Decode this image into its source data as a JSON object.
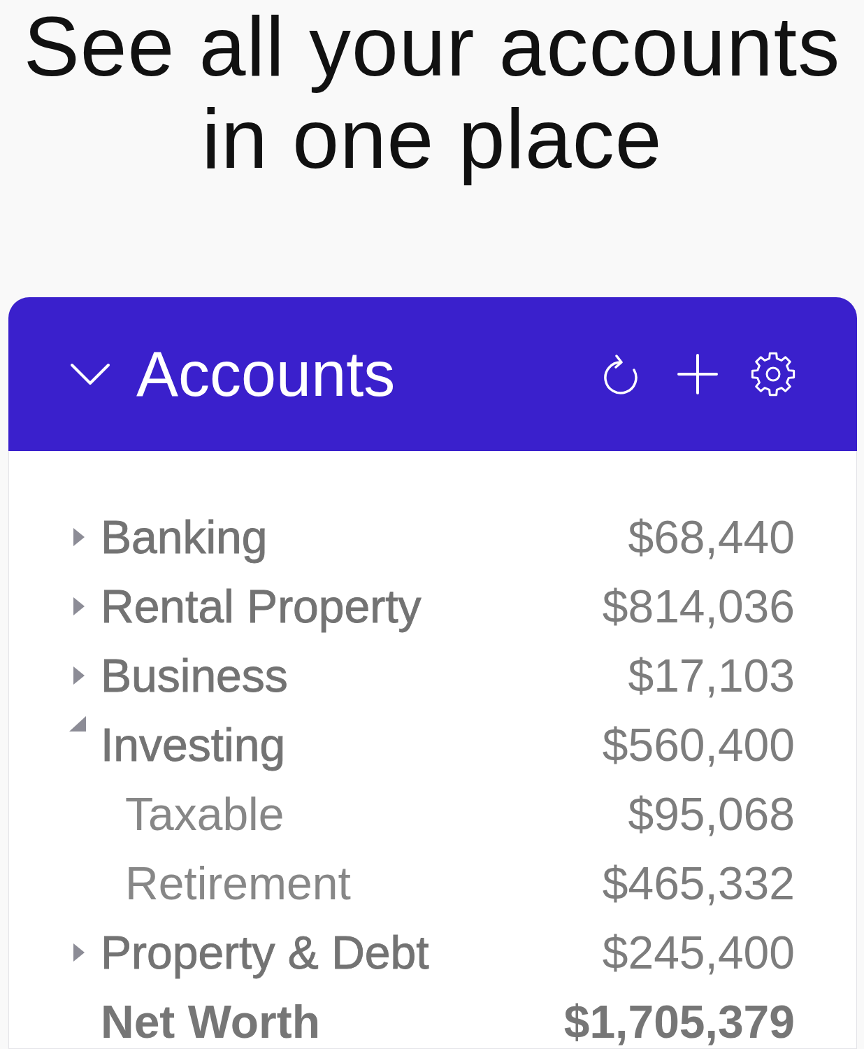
{
  "heading": "See all your accounts in one place",
  "panel": {
    "title": "Accounts",
    "expanded": true,
    "groups": [
      {
        "label": "Banking",
        "value": "$68,440",
        "expanded": false
      },
      {
        "label": "Rental Property",
        "value": "$814,036",
        "expanded": false
      },
      {
        "label": "Business",
        "value": "$17,103",
        "expanded": false
      },
      {
        "label": "Investing",
        "value": "$560,400",
        "expanded": true,
        "children": [
          {
            "label": "Taxable",
            "value": "$95,068"
          },
          {
            "label": "Retirement",
            "value": "$465,332"
          }
        ]
      },
      {
        "label": "Property & Debt",
        "value": "$245,400",
        "expanded": false
      }
    ],
    "net_worth": {
      "label": "Net Worth",
      "value": "$1,705,379"
    }
  }
}
